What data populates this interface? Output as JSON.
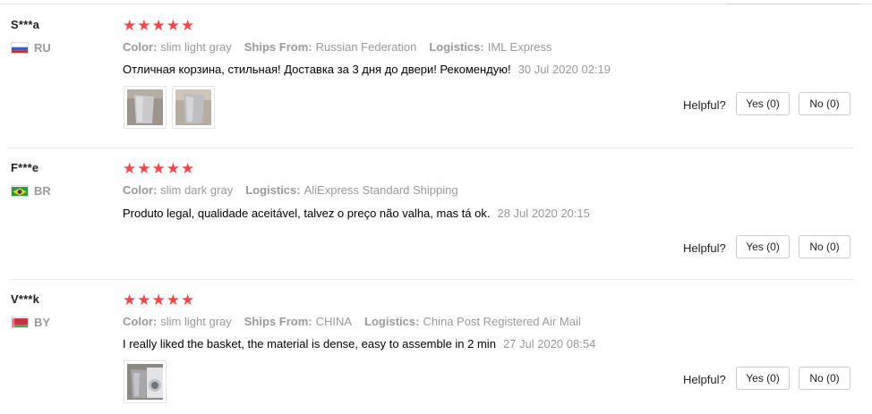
{
  "reviews": [
    {
      "user": "S***a",
      "country": "RU",
      "flag_icon": "russia-flag-icon",
      "rating": 5,
      "color_label": "Color:",
      "color_value": "slim light gray",
      "ships_from_label": "Ships From:",
      "ships_from_value": "Russian Federation",
      "logistics_label": "Logistics:",
      "logistics_value": "IML Express",
      "text": "Отличная корзина, стильная! Доставка за 3 дня до двери! Рекомендую!",
      "date": "30 Jul 2020 02:19",
      "helpful_label": "Helpful?",
      "yes_label": "Yes (0)",
      "no_label": "No (0)"
    },
    {
      "user": "F***e",
      "country": "BR",
      "flag_icon": "brazil-flag-icon",
      "rating": 5,
      "color_label": "Color:",
      "color_value": "slim dark gray",
      "logistics_label": "Logistics:",
      "logistics_value": "AliExpress Standard Shipping",
      "text": "Produto legal, qualidade aceitável, talvez o preço não valha, mas tá ok.",
      "date": "28 Jul 2020 20:15",
      "helpful_label": "Helpful?",
      "yes_label": "Yes (0)",
      "no_label": "No (0)"
    },
    {
      "user": "V***k",
      "country": "BY",
      "flag_icon": "belarus-flag-icon",
      "rating": 5,
      "color_label": "Color:",
      "color_value": "slim light gray",
      "ships_from_label": "Ships From:",
      "ships_from_value": "CHINA",
      "logistics_label": "Logistics:",
      "logistics_value": "China Post Registered Air Mail",
      "text": "I really liked the basket, the material is dense, easy to assemble in 2 min",
      "date": "27 Jul 2020 08:54",
      "helpful_label": "Helpful?",
      "yes_label": "Yes (0)",
      "no_label": "No (0)"
    }
  ],
  "colors": {
    "star": "#f04848",
    "meta": "#999999"
  }
}
